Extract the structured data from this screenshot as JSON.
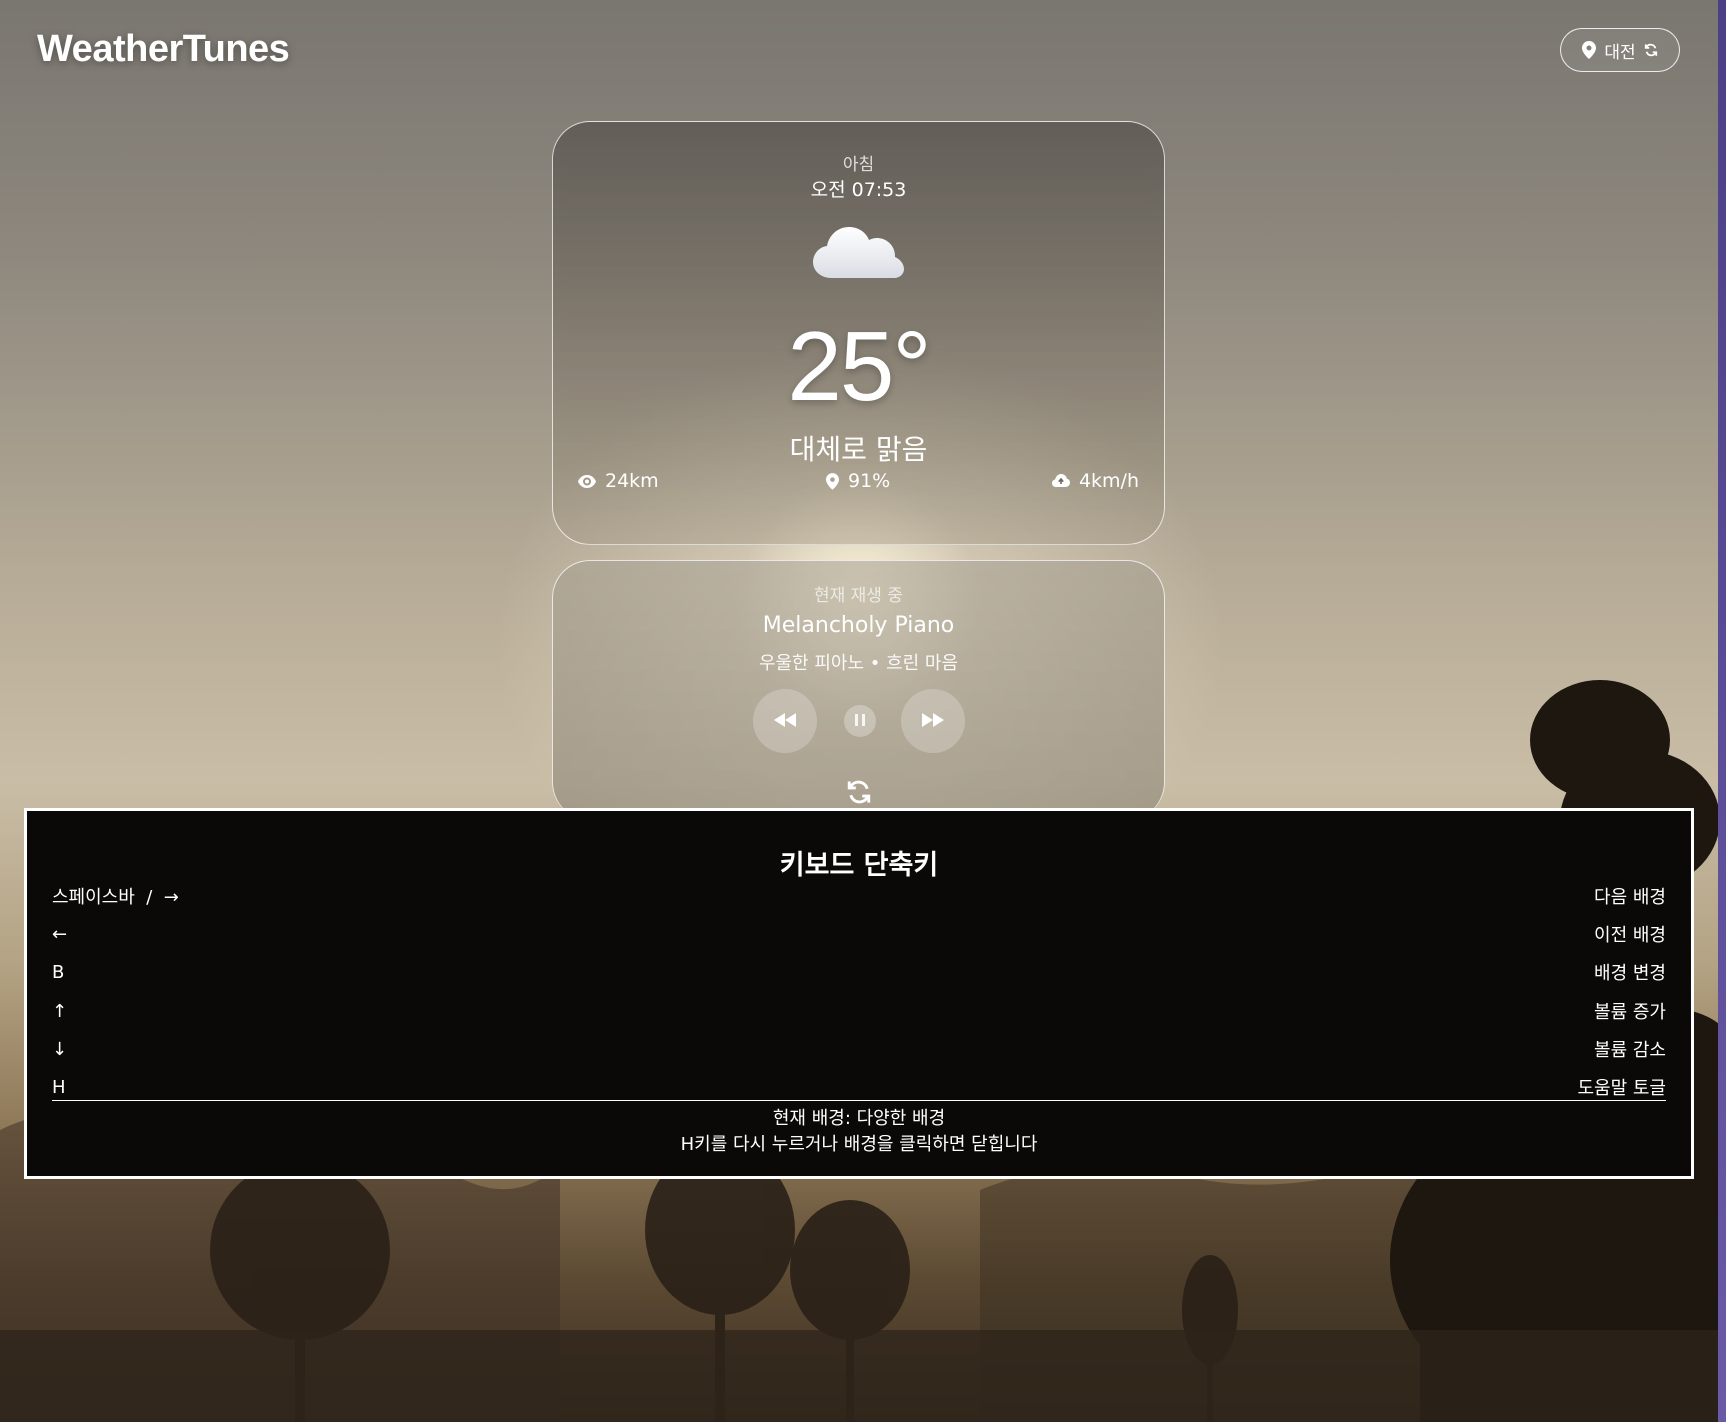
{
  "app": {
    "title": "WeatherTunes"
  },
  "location": {
    "city": "대전"
  },
  "weather": {
    "period": "아침",
    "time": "오전 07:53",
    "icon": "cloud-icon",
    "temperature": "25°",
    "condition": "대체로 맑음",
    "visibility": "24km",
    "humidity": "91%",
    "wind": "4km/h"
  },
  "music": {
    "label": "현재 재생 중",
    "song": "Melancholy Piano",
    "artist_info": "우울한 피아노 • 흐린 마음"
  },
  "help": {
    "title": "키보드 단축키",
    "shortcuts": [
      {
        "key": "스페이스바  /  →",
        "action": "다음 배경"
      },
      {
        "key": "←",
        "action": "이전 배경"
      },
      {
        "key": "B",
        "action": "배경 변경"
      },
      {
        "key": "↑",
        "action": "볼륨 증가"
      },
      {
        "key": "↓",
        "action": "볼륨 감소"
      },
      {
        "key": "H",
        "action": "도움말 토글"
      }
    ],
    "current_background": "현재 배경: 다양한 배경",
    "close_hint": "H키를 다시 누르거나 배경을 클릭하면 닫힙니다"
  }
}
